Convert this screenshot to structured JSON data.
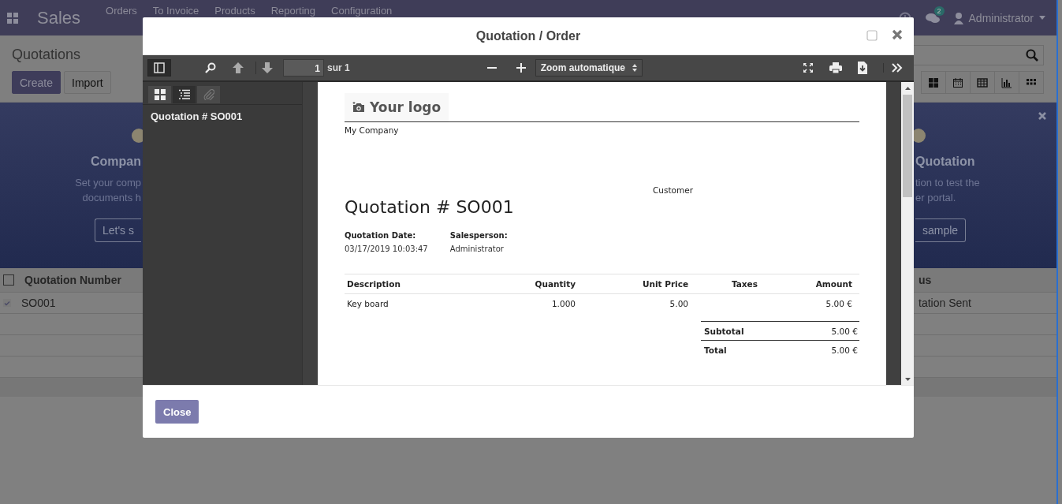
{
  "navbar": {
    "app": "Sales",
    "menu": [
      "Orders",
      "To Invoice",
      "Products",
      "Reporting",
      "Configuration"
    ],
    "messages_count": "2",
    "user": "Administrator"
  },
  "control_panel": {
    "title": "Quotations",
    "buttons": [
      "Create",
      "Import"
    ],
    "views": [
      {
        "kind": "kanban"
      },
      {
        "kind": "calendar"
      },
      {
        "kind": "pivot"
      },
      {
        "kind": "graph"
      },
      {
        "kind": "grid"
      }
    ]
  },
  "banner": {
    "left": {
      "title": "Compan",
      "lines": [
        "Set your comp",
        "documents h"
      ],
      "button": "Let's s"
    },
    "right": {
      "title": "Quotation",
      "lines": [
        "tion to test the",
        "er portal."
      ],
      "button": "sample"
    }
  },
  "list": {
    "header_checked": false,
    "column_left": "Quotation Number",
    "column_right": "us",
    "rows": [
      {
        "number": "SO001",
        "status": "tation Sent",
        "selected": true
      }
    ]
  },
  "dialog": {
    "title": "Quotation / Order",
    "close_button": "Close",
    "viewer": {
      "page": "1",
      "page_count": "sur 1",
      "zoom": "Zoom automatique",
      "sidebar_views": [
        {
          "kind": "thumbnails",
          "selected": false
        },
        {
          "kind": "outline",
          "selected": true
        },
        {
          "kind": "attachments",
          "selected": false
        }
      ],
      "outline": [
        "Quotation # SO001"
      ],
      "document": {
        "logo": "Your logo",
        "company": "My Company",
        "customer_label": "Customer",
        "heading": "Quotation # SO001",
        "info": [
          {
            "label": "Quotation Date:",
            "value": "03/17/2019 10:03:47"
          },
          {
            "label": "Salesperson:",
            "value": "Administrator"
          }
        ],
        "columns": [
          "Description",
          "Quantity",
          "Unit Price",
          "Taxes",
          "Amount"
        ],
        "lines": [
          {
            "description": "Key board",
            "quantity": "1.000",
            "unit_price": "5.00",
            "amount": "5.00 €"
          }
        ],
        "totals": [
          {
            "label": "Subtotal",
            "value": "5.00 €"
          },
          {
            "label": "Total",
            "value": "5.00 €"
          }
        ]
      }
    }
  }
}
